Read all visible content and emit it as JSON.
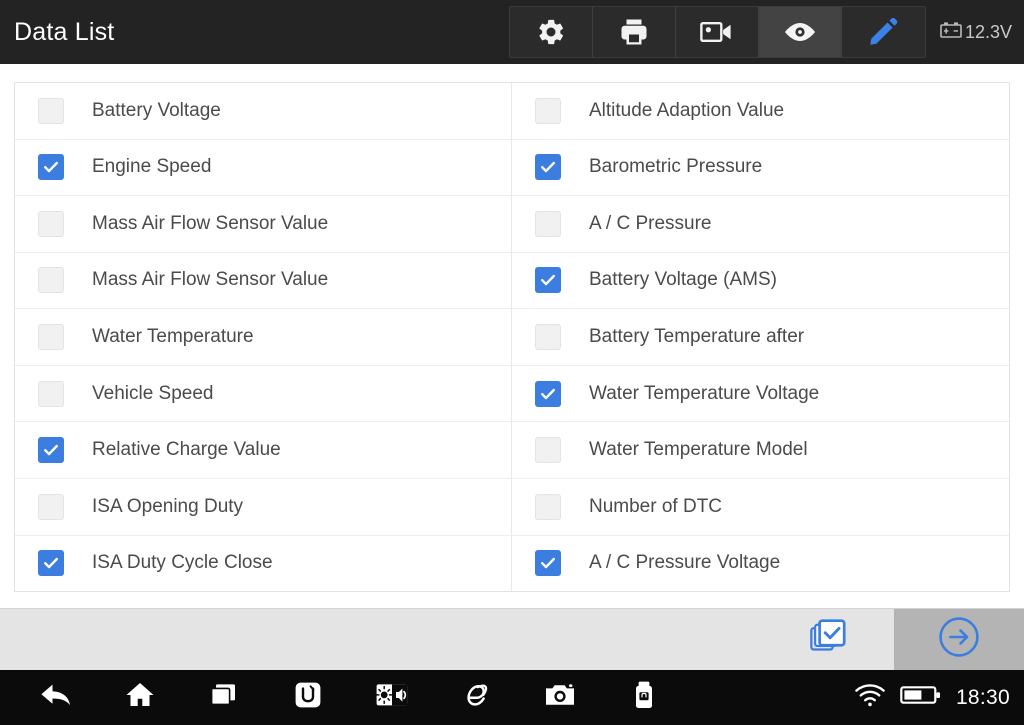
{
  "header": {
    "title": "Data List",
    "toolbar": [
      {
        "name": "settings",
        "icon": "gear-icon",
        "active": false
      },
      {
        "name": "print",
        "icon": "printer-icon",
        "active": false
      },
      {
        "name": "record",
        "icon": "video-camera-icon",
        "active": false
      },
      {
        "name": "view",
        "icon": "eye-icon",
        "active": true
      },
      {
        "name": "edit",
        "icon": "pencil-icon",
        "active": false
      }
    ],
    "battery": {
      "icon": "car-battery-icon",
      "voltage": "12.3V"
    }
  },
  "list": {
    "left": [
      {
        "label": "Battery Voltage",
        "checked": false
      },
      {
        "label": "Engine Speed",
        "checked": true
      },
      {
        "label": "Mass Air Flow Sensor Value",
        "checked": false
      },
      {
        "label": "Mass Air Flow Sensor Value",
        "checked": false
      },
      {
        "label": "Water Temperature",
        "checked": false
      },
      {
        "label": "Vehicle Speed",
        "checked": false
      },
      {
        "label": "Relative Charge Value",
        "checked": true
      },
      {
        "label": "ISA Opening Duty",
        "checked": false
      },
      {
        "label": "ISA Duty Cycle Close",
        "checked": true
      }
    ],
    "right": [
      {
        "label": "Altitude Adaption Value",
        "checked": false
      },
      {
        "label": "Barometric Pressure",
        "checked": true
      },
      {
        "label": "A / C Pressure",
        "checked": false
      },
      {
        "label": "Battery Voltage (AMS)",
        "checked": true
      },
      {
        "label": "Battery Temperature after",
        "checked": false
      },
      {
        "label": "Water Temperature Voltage",
        "checked": true
      },
      {
        "label": "Water Temperature Model",
        "checked": false
      },
      {
        "label": "Number of DTC",
        "checked": false
      },
      {
        "label": "A / C Pressure Voltage",
        "checked": true
      }
    ]
  },
  "action_bar": {
    "select_all": {
      "name": "select-all-button",
      "icon": "stacked-checkbox-icon"
    },
    "next": {
      "name": "next-button",
      "icon": "arrow-right-circle-icon"
    }
  },
  "navbar": {
    "buttons": [
      {
        "name": "back",
        "icon": "back-arrow-icon"
      },
      {
        "name": "home",
        "icon": "home-icon"
      },
      {
        "name": "recents",
        "icon": "recent-apps-icon"
      },
      {
        "name": "diag-app",
        "icon": "u-logo-icon"
      },
      {
        "name": "display",
        "icon": "brightness-volume-icon"
      },
      {
        "name": "browser",
        "icon": "internet-explorer-icon"
      },
      {
        "name": "screenshot",
        "icon": "camera-icon"
      },
      {
        "name": "vci-dongle",
        "icon": "usb-dongle-icon"
      }
    ],
    "status": {
      "wifi": "wifi-icon",
      "battery": "battery-icon",
      "time": "18:30"
    }
  },
  "colors": {
    "accent_blue": "#3b7ee0",
    "header_bg": "#232323",
    "navbar_bg": "#0b0b0b",
    "action_bar_bg": "#e4e4e4",
    "next_btn_bg": "#b4b4b4",
    "row_text": "#4b4b4b"
  }
}
